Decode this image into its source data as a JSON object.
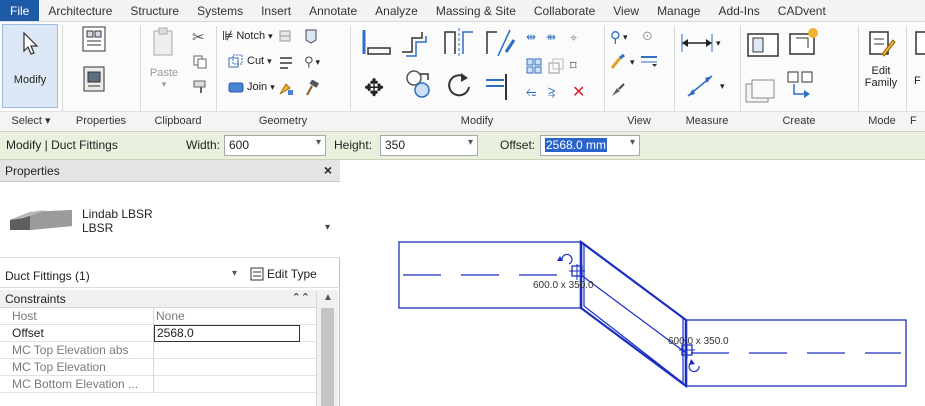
{
  "tabs": [
    "File",
    "Architecture",
    "Structure",
    "Systems",
    "Insert",
    "Annotate",
    "Analyze",
    "Massing & Site",
    "Collaborate",
    "View",
    "Manage",
    "Add-Ins",
    "CADvent"
  ],
  "ribbon": {
    "select_panel": {
      "modify_label": "Modify",
      "title": "Select",
      "dropdown": "▾"
    },
    "properties_panel": {
      "title": "Properties"
    },
    "clipboard_panel": {
      "paste_label": "Paste",
      "title": "Clipboard"
    },
    "geometry_panel": {
      "notch_label": "Notch",
      "cut_label": "Cut",
      "join_label": "Join",
      "title": "Geometry"
    },
    "modify_panel": {
      "title": "Modify"
    },
    "view_panel": {
      "title": "View"
    },
    "measure_panel": {
      "title": "Measure"
    },
    "create_panel": {
      "title": "Create"
    },
    "mode_panel": {
      "edit_family_line1": "Edit",
      "edit_family_line2": "Family",
      "title": "Mode",
      "cut_letter": "F"
    }
  },
  "options_bar": {
    "context": "Modify | Duct Fittings",
    "width_label": "Width:",
    "width_value": "600",
    "height_label": "Height:",
    "height_value": "350",
    "offset_label": "Offset:",
    "offset_value": "2568.0 mm"
  },
  "properties": {
    "header": "Properties",
    "close": "×",
    "type_name_line1": "Lindab LBSR",
    "type_name_line2": "LBSR",
    "instance_filter": "Duct Fittings (1)",
    "edit_type": "Edit Type",
    "group": "Constraints",
    "rows": [
      {
        "name": "Host",
        "value": "None"
      },
      {
        "name": "Offset",
        "value": "2568.0"
      },
      {
        "name": "MC Top Elevation abs",
        "value": ""
      },
      {
        "name": "MC Top Elevation",
        "value": ""
      },
      {
        "name": "MC Bottom Elevation ...",
        "value": ""
      }
    ]
  },
  "canvas": {
    "dim_left": "600.0 x 350.0",
    "dim_right": "600.0 x 350.0"
  },
  "colors": {
    "file_tab": "#1f5aa6",
    "options_bar": "#e9f1de",
    "duct_line": "#1a2fbf",
    "selection": "#2a63c9"
  }
}
